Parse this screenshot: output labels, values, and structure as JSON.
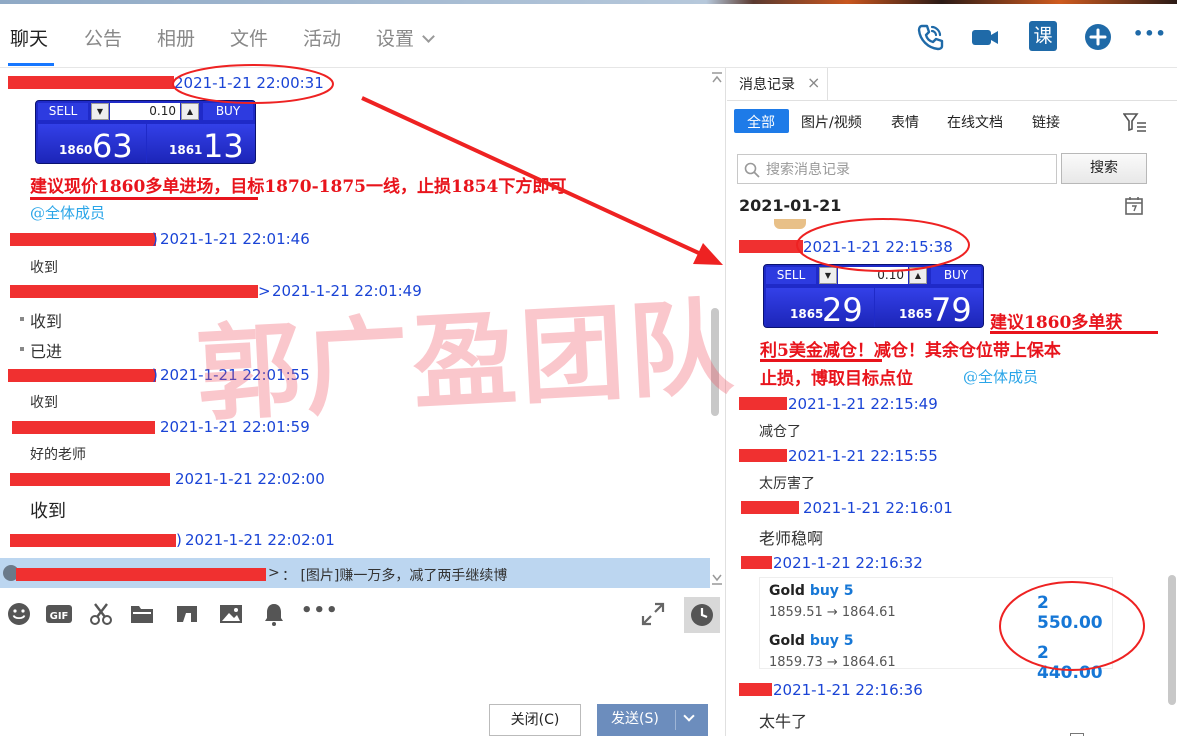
{
  "nav": {
    "tabs": [
      "聊天",
      "公告",
      "相册",
      "文件",
      "活动",
      "设置"
    ],
    "icons": [
      "phone-icon",
      "video-icon",
      "lesson-icon",
      "add-icon",
      "more-icon"
    ],
    "lesson_icon_label": "课",
    "more_icon_label": "•••"
  },
  "chat": {
    "messages": [
      {
        "time": "2021-1-21 22:00:31"
      },
      {
        "time": "2021-1-21 22:01:46",
        "text": "收到"
      },
      {
        "time": "2021-1-21 22:01:49",
        "lines": [
          "收到",
          "已进"
        ],
        "suffix": ">"
      },
      {
        "time": "2021-1-21 22:01:55",
        "text": "收到"
      },
      {
        "time": "2021-1-21 22:01:59",
        "text": "好的老师"
      },
      {
        "time": "2021-1-21 22:02:00",
        "text": "收到"
      },
      {
        "time": "2021-1-21 22:02:01"
      }
    ],
    "paren_close": ")",
    "widget": {
      "sell": "SELL",
      "buy": "BUY",
      "qty": "0.10",
      "sell_small": "1860",
      "sell_big": "63",
      "buy_small": "1861",
      "buy_big": "13"
    },
    "note": "建议现价1860多单进场，目标1870-1875一线，止损1854下方即可",
    "mention": "@全体成员",
    "banner": {
      "suffix": ">",
      "text": "：  [图片]赚一万多，减了两手继续博"
    },
    "watermark": "郭广盈团队",
    "close_button": "关闭(C)",
    "send_button": "发送(S)"
  },
  "history": {
    "title": "消息记录",
    "close_label": "×",
    "filters": [
      "全部",
      "图片/视频",
      "表情",
      "在线文档",
      "链接"
    ],
    "search_placeholder": "搜索消息记录",
    "search_button": "搜索",
    "date": "2021-01-21",
    "messages": [
      {
        "time": "2021-1-21 22:15:38"
      },
      {
        "time": "2021-1-21 22:15:49",
        "text": "减仓了"
      },
      {
        "time": "2021-1-21 22:15:55",
        "text": "太厉害了"
      },
      {
        "time": "2021-1-21 22:16:01",
        "text": "老师稳啊"
      },
      {
        "time": "2021-1-21 22:16:32"
      },
      {
        "time": "2021-1-21 22:16:36",
        "text": "太牛了"
      }
    ],
    "widget": {
      "sell": "SELL",
      "buy": "BUY",
      "qty": "0.10",
      "sell_small": "1865",
      "sell_big": "29",
      "buy_small": "1865",
      "buy_big": "79"
    },
    "note": [
      "建议1860多单获",
      "利5美金减仓！减仓！其余仓位带上保本",
      "止损，博取目标点位"
    ],
    "mention": "@全体成员",
    "trades": [
      {
        "label": "Gold",
        "action": "buy 5",
        "prices": "1859.51 → 1864.61",
        "amount": "2 550.00"
      },
      {
        "label": "Gold",
        "action": "buy 5",
        "prices": "1859.73 → 1864.61",
        "amount": "2 440.00"
      }
    ]
  },
  "colors": {
    "accent": "#1677ff",
    "timestamp": "#1a44d6",
    "annotation": "#e8141c",
    "mention": "#2aa5e8",
    "banner": "#bcd6f0"
  }
}
